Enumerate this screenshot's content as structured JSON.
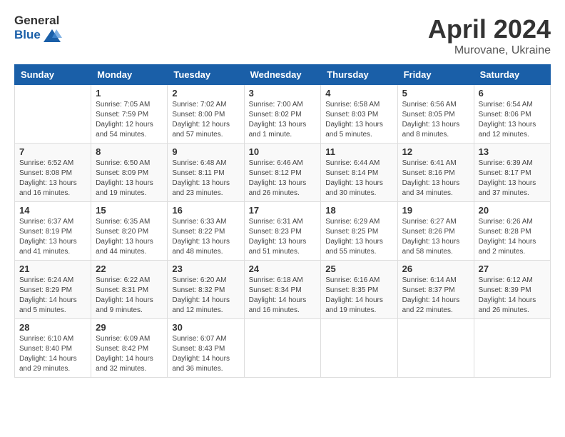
{
  "header": {
    "logo_general": "General",
    "logo_blue": "Blue",
    "month_title": "April 2024",
    "location": "Murovane, Ukraine"
  },
  "weekdays": [
    "Sunday",
    "Monday",
    "Tuesday",
    "Wednesday",
    "Thursday",
    "Friday",
    "Saturday"
  ],
  "weeks": [
    [
      {
        "day": "",
        "sunrise": "",
        "sunset": "",
        "daylight": ""
      },
      {
        "day": "1",
        "sunrise": "Sunrise: 7:05 AM",
        "sunset": "Sunset: 7:59 PM",
        "daylight": "Daylight: 12 hours and 54 minutes."
      },
      {
        "day": "2",
        "sunrise": "Sunrise: 7:02 AM",
        "sunset": "Sunset: 8:00 PM",
        "daylight": "Daylight: 12 hours and 57 minutes."
      },
      {
        "day": "3",
        "sunrise": "Sunrise: 7:00 AM",
        "sunset": "Sunset: 8:02 PM",
        "daylight": "Daylight: 13 hours and 1 minute."
      },
      {
        "day": "4",
        "sunrise": "Sunrise: 6:58 AM",
        "sunset": "Sunset: 8:03 PM",
        "daylight": "Daylight: 13 hours and 5 minutes."
      },
      {
        "day": "5",
        "sunrise": "Sunrise: 6:56 AM",
        "sunset": "Sunset: 8:05 PM",
        "daylight": "Daylight: 13 hours and 8 minutes."
      },
      {
        "day": "6",
        "sunrise": "Sunrise: 6:54 AM",
        "sunset": "Sunset: 8:06 PM",
        "daylight": "Daylight: 13 hours and 12 minutes."
      }
    ],
    [
      {
        "day": "7",
        "sunrise": "Sunrise: 6:52 AM",
        "sunset": "Sunset: 8:08 PM",
        "daylight": "Daylight: 13 hours and 16 minutes."
      },
      {
        "day": "8",
        "sunrise": "Sunrise: 6:50 AM",
        "sunset": "Sunset: 8:09 PM",
        "daylight": "Daylight: 13 hours and 19 minutes."
      },
      {
        "day": "9",
        "sunrise": "Sunrise: 6:48 AM",
        "sunset": "Sunset: 8:11 PM",
        "daylight": "Daylight: 13 hours and 23 minutes."
      },
      {
        "day": "10",
        "sunrise": "Sunrise: 6:46 AM",
        "sunset": "Sunset: 8:12 PM",
        "daylight": "Daylight: 13 hours and 26 minutes."
      },
      {
        "day": "11",
        "sunrise": "Sunrise: 6:44 AM",
        "sunset": "Sunset: 8:14 PM",
        "daylight": "Daylight: 13 hours and 30 minutes."
      },
      {
        "day": "12",
        "sunrise": "Sunrise: 6:41 AM",
        "sunset": "Sunset: 8:16 PM",
        "daylight": "Daylight: 13 hours and 34 minutes."
      },
      {
        "day": "13",
        "sunrise": "Sunrise: 6:39 AM",
        "sunset": "Sunset: 8:17 PM",
        "daylight": "Daylight: 13 hours and 37 minutes."
      }
    ],
    [
      {
        "day": "14",
        "sunrise": "Sunrise: 6:37 AM",
        "sunset": "Sunset: 8:19 PM",
        "daylight": "Daylight: 13 hours and 41 minutes."
      },
      {
        "day": "15",
        "sunrise": "Sunrise: 6:35 AM",
        "sunset": "Sunset: 8:20 PM",
        "daylight": "Daylight: 13 hours and 44 minutes."
      },
      {
        "day": "16",
        "sunrise": "Sunrise: 6:33 AM",
        "sunset": "Sunset: 8:22 PM",
        "daylight": "Daylight: 13 hours and 48 minutes."
      },
      {
        "day": "17",
        "sunrise": "Sunrise: 6:31 AM",
        "sunset": "Sunset: 8:23 PM",
        "daylight": "Daylight: 13 hours and 51 minutes."
      },
      {
        "day": "18",
        "sunrise": "Sunrise: 6:29 AM",
        "sunset": "Sunset: 8:25 PM",
        "daylight": "Daylight: 13 hours and 55 minutes."
      },
      {
        "day": "19",
        "sunrise": "Sunrise: 6:27 AM",
        "sunset": "Sunset: 8:26 PM",
        "daylight": "Daylight: 13 hours and 58 minutes."
      },
      {
        "day": "20",
        "sunrise": "Sunrise: 6:26 AM",
        "sunset": "Sunset: 8:28 PM",
        "daylight": "Daylight: 14 hours and 2 minutes."
      }
    ],
    [
      {
        "day": "21",
        "sunrise": "Sunrise: 6:24 AM",
        "sunset": "Sunset: 8:29 PM",
        "daylight": "Daylight: 14 hours and 5 minutes."
      },
      {
        "day": "22",
        "sunrise": "Sunrise: 6:22 AM",
        "sunset": "Sunset: 8:31 PM",
        "daylight": "Daylight: 14 hours and 9 minutes."
      },
      {
        "day": "23",
        "sunrise": "Sunrise: 6:20 AM",
        "sunset": "Sunset: 8:32 PM",
        "daylight": "Daylight: 14 hours and 12 minutes."
      },
      {
        "day": "24",
        "sunrise": "Sunrise: 6:18 AM",
        "sunset": "Sunset: 8:34 PM",
        "daylight": "Daylight: 14 hours and 16 minutes."
      },
      {
        "day": "25",
        "sunrise": "Sunrise: 6:16 AM",
        "sunset": "Sunset: 8:35 PM",
        "daylight": "Daylight: 14 hours and 19 minutes."
      },
      {
        "day": "26",
        "sunrise": "Sunrise: 6:14 AM",
        "sunset": "Sunset: 8:37 PM",
        "daylight": "Daylight: 14 hours and 22 minutes."
      },
      {
        "day": "27",
        "sunrise": "Sunrise: 6:12 AM",
        "sunset": "Sunset: 8:39 PM",
        "daylight": "Daylight: 14 hours and 26 minutes."
      }
    ],
    [
      {
        "day": "28",
        "sunrise": "Sunrise: 6:10 AM",
        "sunset": "Sunset: 8:40 PM",
        "daylight": "Daylight: 14 hours and 29 minutes."
      },
      {
        "day": "29",
        "sunrise": "Sunrise: 6:09 AM",
        "sunset": "Sunset: 8:42 PM",
        "daylight": "Daylight: 14 hours and 32 minutes."
      },
      {
        "day": "30",
        "sunrise": "Sunrise: 6:07 AM",
        "sunset": "Sunset: 8:43 PM",
        "daylight": "Daylight: 14 hours and 36 minutes."
      },
      {
        "day": "",
        "sunrise": "",
        "sunset": "",
        "daylight": ""
      },
      {
        "day": "",
        "sunrise": "",
        "sunset": "",
        "daylight": ""
      },
      {
        "day": "",
        "sunrise": "",
        "sunset": "",
        "daylight": ""
      },
      {
        "day": "",
        "sunrise": "",
        "sunset": "",
        "daylight": ""
      }
    ]
  ]
}
